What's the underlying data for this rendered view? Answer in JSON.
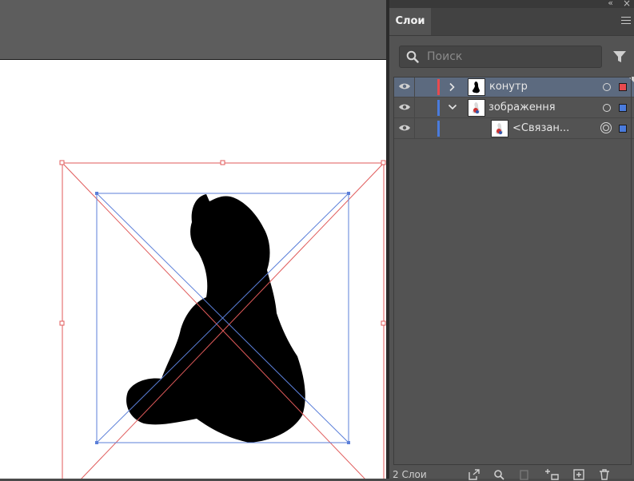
{
  "panel": {
    "tab_label": "Слои",
    "search_placeholder": "Поиск",
    "layer_count": "2 Слои"
  },
  "layers": [
    {
      "name": "конутр",
      "color": "#e84a4f",
      "expanded": false,
      "selected": true
    },
    {
      "name": "зображення",
      "color": "#4a7bdc",
      "expanded": true,
      "selected": false
    },
    {
      "name": "<Связан...",
      "color": "#4a7bdc",
      "child": true,
      "selected": false
    }
  ],
  "colors": {
    "layer1": "#e84a4f",
    "layer2": "#4a7bdc",
    "selected_row": "#5c6a7f"
  },
  "icons": [
    "eye-icon",
    "chevron-right-icon",
    "chevron-down-icon",
    "search-icon",
    "filter-icon",
    "export-icon",
    "locate-icon",
    "clip-mask-icon",
    "sublayer-icon",
    "new-layer-icon",
    "trash-icon"
  ]
}
